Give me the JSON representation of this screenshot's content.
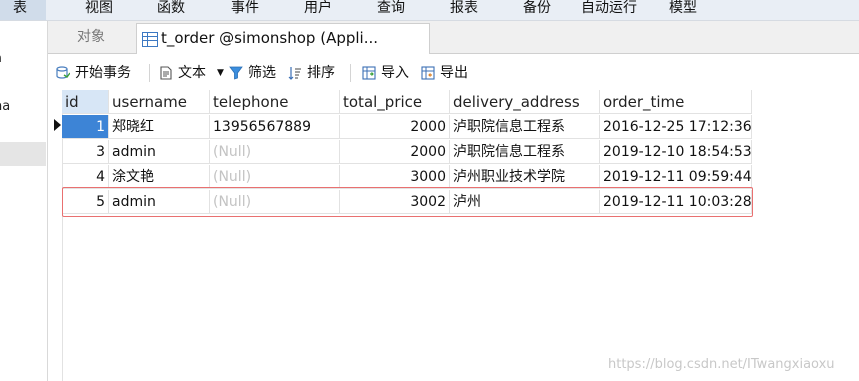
{
  "menu": {
    "items": [
      "表",
      "视图",
      "函数",
      "事件",
      "用户",
      "查询",
      "报表",
      "备份",
      "自动运行",
      "模型"
    ]
  },
  "left_panel": {
    "items": [
      "a",
      "na"
    ]
  },
  "tabs": {
    "objects_label": "对象",
    "active_label": "t_order @simonshop (Appli..."
  },
  "toolbar": {
    "begin_transaction": "开始事务",
    "text": "文本",
    "filter": "筛选",
    "sort": "排序",
    "import": "导入",
    "export": "导出"
  },
  "grid": {
    "columns": [
      "id",
      "username",
      "telephone",
      "total_price",
      "delivery_address",
      "order_time"
    ],
    "rows": [
      [
        "1",
        "郑晓红",
        "13956567889",
        "2000",
        "泸职院信息工程系",
        "2016-12-25 17:12:36"
      ],
      [
        "3",
        "admin",
        "(Null)",
        "2000",
        "泸职院信息工程系",
        "2019-12-10 18:54:53"
      ],
      [
        "4",
        "涂文艳",
        "(Null)",
        "3000",
        "泸州职业技术学院",
        "2019-12-11 09:59:44"
      ],
      [
        "5",
        "admin",
        "(Null)",
        "3002",
        "泸州",
        "2019-12-11 10:03:28"
      ]
    ]
  },
  "watermark": "https://blog.csdn.net/ITwangxiaoxu",
  "colors": {
    "selection": "#3d84d6",
    "highlight_border": "#e97070",
    "null_text": "#c3c3c3"
  }
}
